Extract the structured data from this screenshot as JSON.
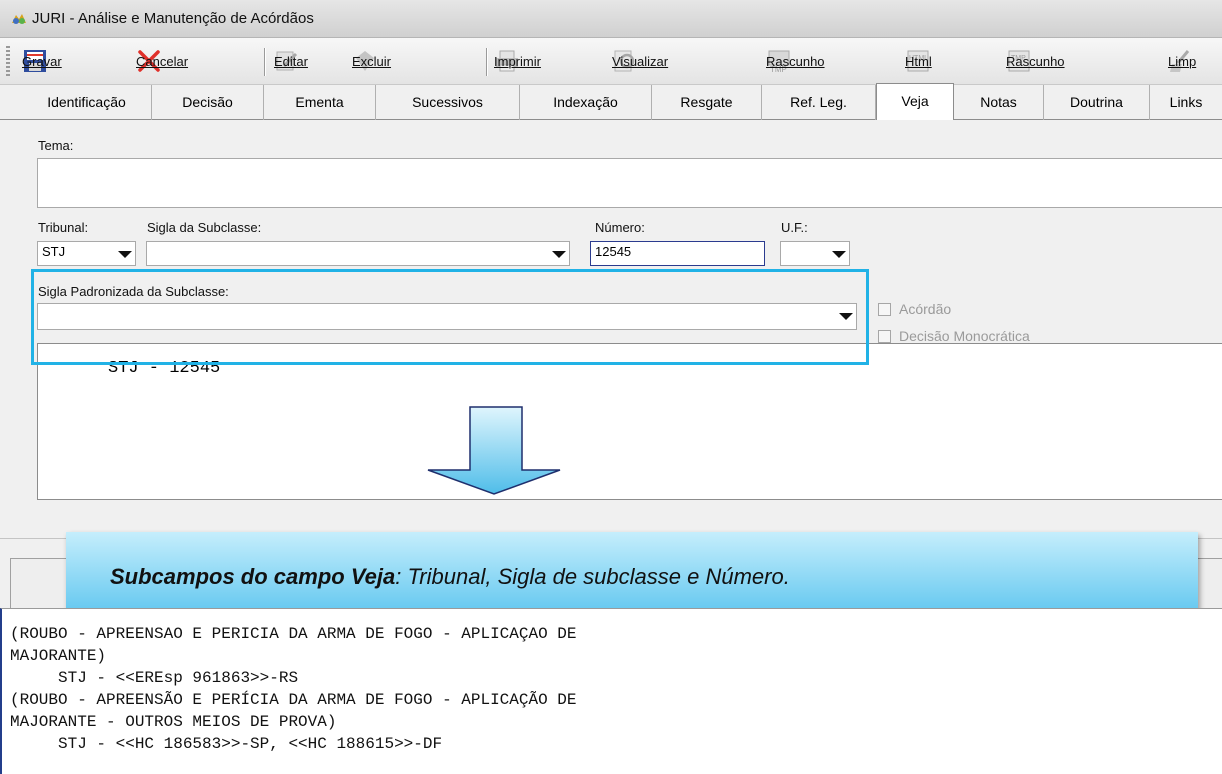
{
  "window": {
    "title": "JURI - Análise e Manutenção de Acórdãos",
    "icon": "app-icon"
  },
  "toolbar": {
    "gravar": "Gravar",
    "cancelar": "Cancelar",
    "editar": "Editar",
    "excluir": "Excluir",
    "imprimir": "Imprimir",
    "visualizar": "Visualizar",
    "rascunho": "Rascunho",
    "html": "Html",
    "rascunho2": "Rascunho",
    "limp": "Limp"
  },
  "tabs": [
    {
      "label": "Identificação"
    },
    {
      "label": "Decisão"
    },
    {
      "label": "Ementa"
    },
    {
      "label": "Sucessivos"
    },
    {
      "label": "Indexação"
    },
    {
      "label": "Resgate"
    },
    {
      "label": "Ref. Leg."
    },
    {
      "label": "Veja"
    },
    {
      "label": "Notas"
    },
    {
      "label": "Doutrina"
    },
    {
      "label": "Links"
    }
  ],
  "active_tab": "Veja",
  "form": {
    "tema_label": "Tema:",
    "tema_value": "",
    "tribunal_label": "Tribunal:",
    "tribunal_value": "STJ",
    "sigla_subclasse_label": "Sigla da Subclasse:",
    "sigla_subclasse_value": "",
    "numero_label": "Número:",
    "numero_value": "12545",
    "uf_label": "U.F.:",
    "uf_value": "",
    "sigla_padronizada_label": "Sigla Padronizada da Subclasse:",
    "sigla_padronizada_value": "",
    "acordao_label": "Acórdão",
    "decisao_monocratica_label": "Decisão Monocrática"
  },
  "preview": {
    "text": "STJ -  12545"
  },
  "callout": {
    "bold": "Subcampos do campo Veja",
    "rest": ": Tribunal, Sigla de subclasse e Número."
  },
  "notes": [
    "(ROUBO - APREENSAO E PERICIA DA ARMA DE FOGO - APLICAÇAO DE",
    "MAJORANTE)",
    "     STJ - <<EREsp 961863>>-RS",
    "(ROUBO - APREENSÃO E PERÍCIA DA ARMA DE FOGO - APLICAÇÃO DE",
    "MAJORANTE - OUTROS MEIOS DE PROVA)",
    "     STJ - <<HC 186583>>-SP, <<HC 188615>>-DF"
  ],
  "colors": {
    "highlight": "#21b2e6",
    "callout_top": "#c5eefc",
    "callout_bottom": "#58c3ee",
    "arrow_top": "#dff5fd",
    "arrow_bottom": "#4fbde9"
  }
}
